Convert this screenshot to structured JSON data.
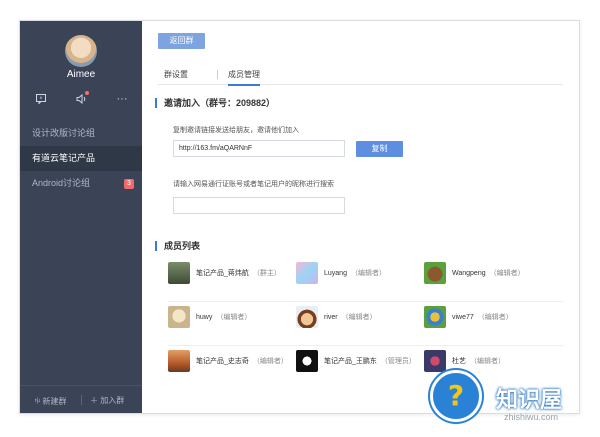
{
  "sidebar": {
    "user_name": "Aimee",
    "icons": [
      "message-icon",
      "speaker-icon",
      "more-icon"
    ],
    "more_glyph": "···",
    "groups": [
      {
        "label": "设计改版讨论组",
        "active": false
      },
      {
        "label": "有道云笔记产品",
        "active": true
      },
      {
        "label": "Android讨论组",
        "active": false,
        "badge": "3"
      }
    ],
    "footer": {
      "new_group": "新建群",
      "join_group": "加入群"
    }
  },
  "main": {
    "back_label": "返回群",
    "tabs": [
      "群设置",
      "成员管理"
    ],
    "active_tab": 1,
    "invite": {
      "title": "邀请加入（群号：209882）",
      "copy_hint": "复制邀请链接发送给朋友，邀请他们加入",
      "link_value": "http://163.fm/aQARNnF",
      "copy_label": "复制",
      "search_hint": "请输入网易通行证账号或者笔记用户的昵称进行搜索",
      "search_value": ""
    },
    "members_title": "成员列表",
    "members": [
      [
        {
          "name": "笔记产品_蒋炜航",
          "role": "（群主）"
        },
        {
          "name": "Luyang",
          "role": "（编辑者）"
        },
        {
          "name": "Wangpeng",
          "role": "（编辑者）"
        }
      ],
      [
        {
          "name": "huwy",
          "role": "（编辑者）"
        },
        {
          "name": "river",
          "role": "（编辑者）"
        },
        {
          "name": "viwe77",
          "role": "（编辑者）"
        }
      ],
      [
        {
          "name": "笔记产品_史志奇",
          "role": "（编辑者）"
        },
        {
          "name": "笔记产品_王鹏东",
          "role": "（管理员）"
        },
        {
          "name": "杜艺",
          "role": "（编辑者）"
        }
      ]
    ]
  },
  "watermark": {
    "brand": "知识屋",
    "url": "zhishiwu.com"
  },
  "colors": {
    "sidebar": "#3a4456",
    "accent": "#3b7ad8",
    "button": "#5d8ee0",
    "badge": "#f06a6a"
  }
}
